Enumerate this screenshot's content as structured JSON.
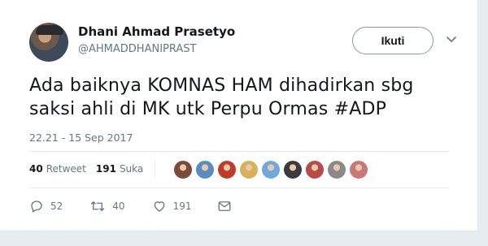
{
  "user": {
    "name": "Dhani Ahmad Prasetyo",
    "handle": "@AHMADDHANIPRAST"
  },
  "follow_button": {
    "label": "Ikuti"
  },
  "tweet": {
    "line1": "Ada baiknya KOMNAS HAM dihadirkan sbg",
    "line2": "saksi ahli di MK utk Perpu Ormas #ADP",
    "timestamp": "22.21 - 15 Sep 2017"
  },
  "stats": {
    "retweets_count": "40",
    "retweets_label": "Retweet",
    "likes_count": "191",
    "likes_label": "Suka"
  },
  "liker_avatars": [
    {
      "color": "#7a4a3a"
    },
    {
      "color": "#5a8bc2"
    },
    {
      "color": "#c23b2a"
    },
    {
      "color": "#d9b15a"
    },
    {
      "color": "#6fa8dc"
    },
    {
      "color": "#3b3b3b"
    },
    {
      "color": "#b84a4a"
    },
    {
      "color": "#8a8a8a"
    },
    {
      "color": "#c97878"
    }
  ],
  "actions": {
    "reply_count": "52",
    "retweet_count": "40",
    "like_count": "191"
  },
  "icons": {
    "reply": "reply-icon",
    "retweet": "retweet-icon",
    "like": "heart-icon",
    "dm": "envelope-icon",
    "more": "chevron-down-icon"
  },
  "colors": {
    "text": "#14171a",
    "muted": "#657786",
    "border": "#e6ecf0"
  }
}
